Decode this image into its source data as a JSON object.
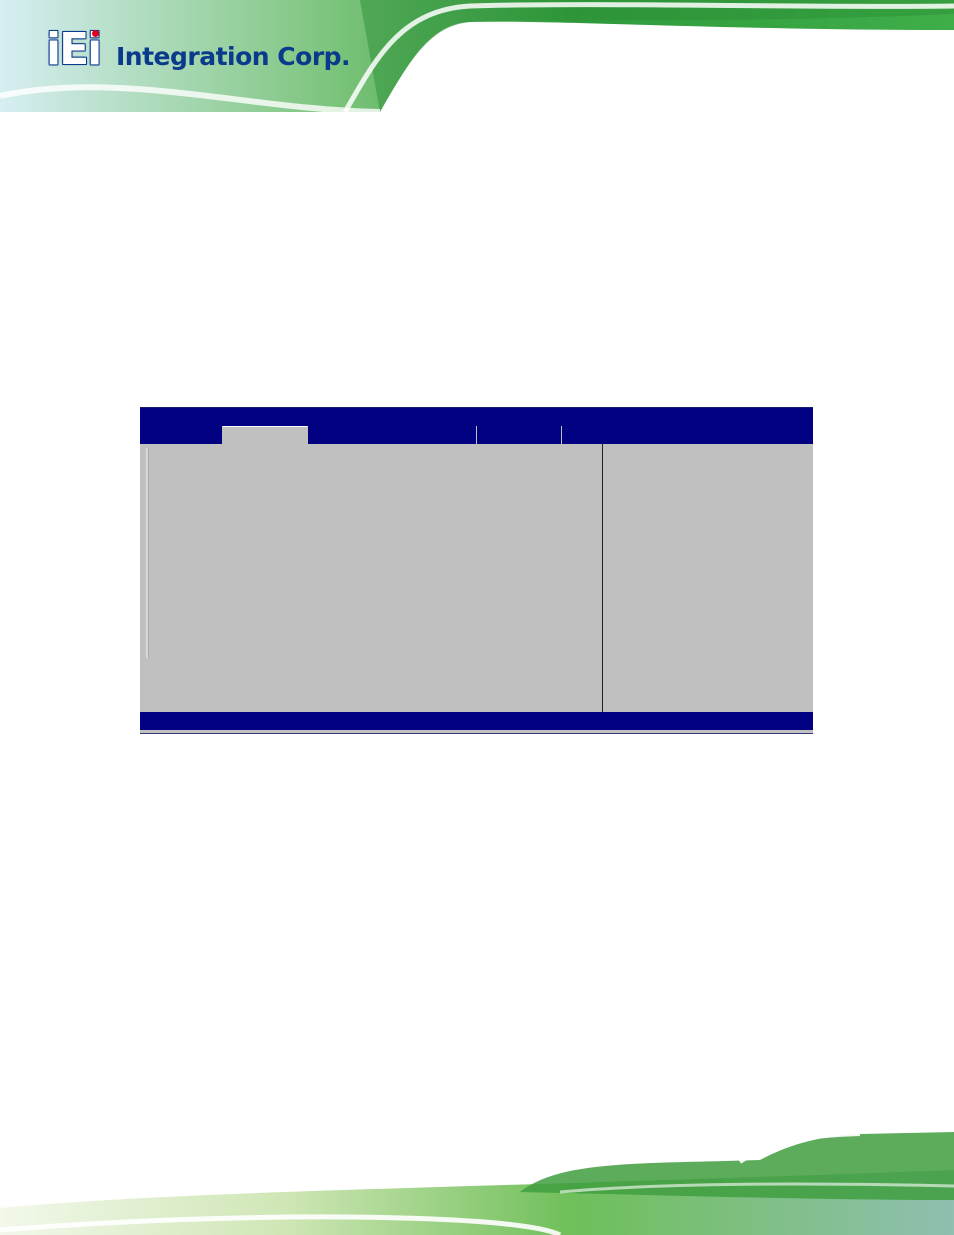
{
  "header": {
    "logo": {
      "mark": "iEi",
      "name": "Integration Corp."
    }
  },
  "bios_screen": {
    "tabs": [
      {
        "active": false
      },
      {
        "active": true
      },
      {
        "active": false
      },
      {
        "active": false
      },
      {
        "active": false
      }
    ]
  },
  "colors": {
    "bios_blue": "#000080",
    "bios_gray": "#c0c0c0",
    "banner_green": "#3aa53a",
    "logo_blue": "#0a3a8c",
    "logo_red": "#e0001b"
  }
}
